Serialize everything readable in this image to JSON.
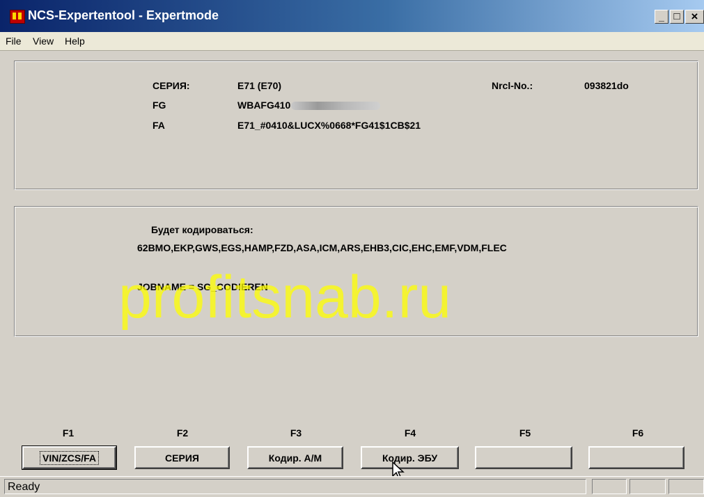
{
  "window": {
    "title": "NCS-Expertentool - Expertmode",
    "minimize": "_",
    "maximize": "□",
    "close": "×"
  },
  "menu": [
    "File",
    "View",
    "Help"
  ],
  "vehicle": {
    "series_label": "СЕРИЯ:",
    "series_value": "E71 (E70)",
    "fg_label": "FG",
    "fg_value": "WBAFG410",
    "fa_label": "FA",
    "fa_value": "E71_#0410&LUCX%0668*FG41$1CB$21",
    "nrcl_label": "Nrcl-No.:",
    "nrcl_value": "093821do"
  },
  "coding": {
    "heading": "Будет кодироваться:",
    "modules": "62BMO,EKP,GWS,EGS,HAMP,FZD,ASA,ICM,ARS,EHB3,CIC,EHC,EMF,VDM,FLEC",
    "jobname": "JOBNAME = SG_CODIEREN"
  },
  "watermark": "profitsnab.ru",
  "function_keys": [
    {
      "key": "F1",
      "label": "VIN/ZCS/FA"
    },
    {
      "key": "F2",
      "label": "СЕРИЯ"
    },
    {
      "key": "F3",
      "label": "Кодир. А/М"
    },
    {
      "key": "F4",
      "label": "Кодир. ЭБУ"
    },
    {
      "key": "F5",
      "label": ""
    },
    {
      "key": "F6",
      "label": ""
    }
  ],
  "status": {
    "text": "Ready"
  }
}
